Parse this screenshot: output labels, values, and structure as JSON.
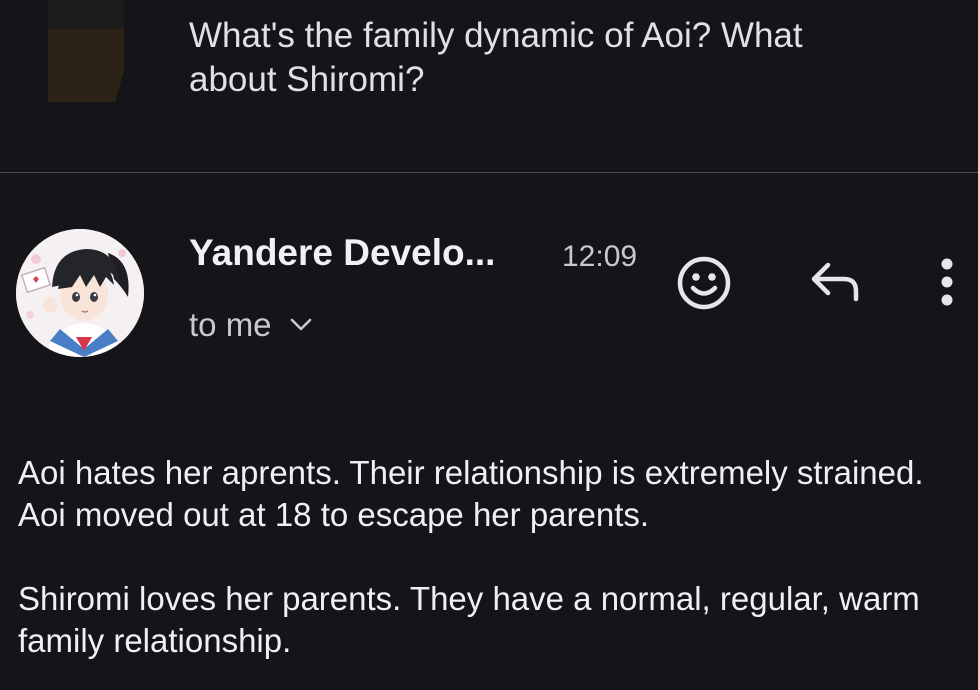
{
  "previous_message": {
    "snippet": "What's the family dynamic of Aoi? What about Shiromi?"
  },
  "message": {
    "sender_name": "Yandere Develo...",
    "time": "12:09",
    "recipient_label": "to me",
    "paragraphs": [
      "Aoi hates her aprents. Their relationship is extremely strained. Aoi moved out at 18 to escape her parents.",
      "Shiromi loves her parents. They have a normal, regular, warm family relationship."
    ]
  },
  "icons": {
    "emoji": "smiley-reaction-icon",
    "reply": "reply-arrow-icon",
    "more": "more-vertical-icon",
    "expand": "chevron-down-icon"
  },
  "colors": {
    "background": "#141419",
    "text_primary": "#f0f0f2",
    "text_secondary": "#c8c9cc",
    "divider": "#4a4a50"
  }
}
